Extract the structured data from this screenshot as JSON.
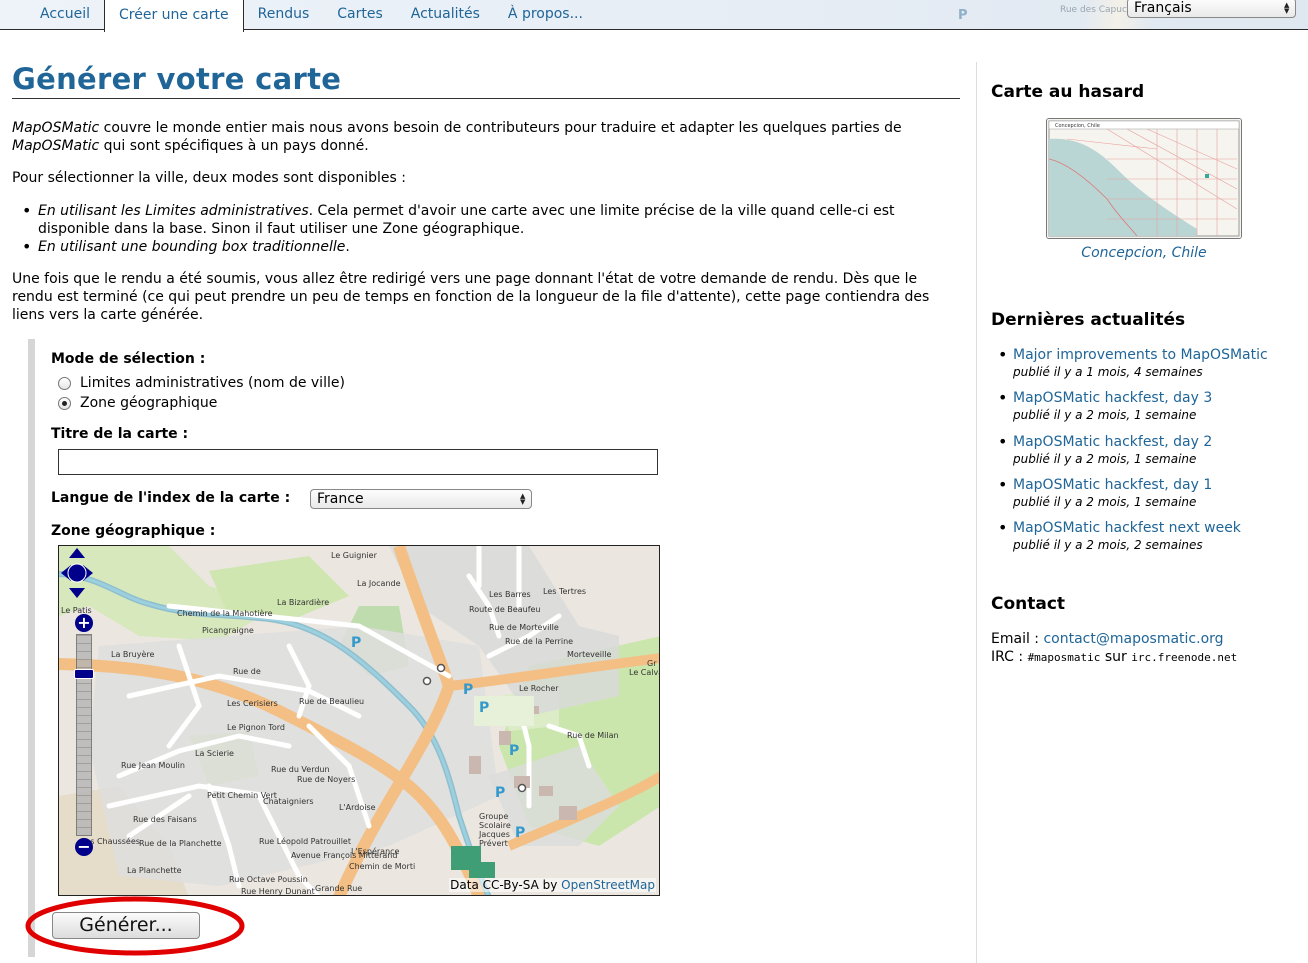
{
  "nav": {
    "tabs": [
      {
        "label": "Accueil",
        "active": false
      },
      {
        "label": "Créer une carte",
        "active": true
      },
      {
        "label": "Rendus",
        "active": false
      },
      {
        "label": "Cartes",
        "active": false
      },
      {
        "label": "Actualités",
        "active": false
      },
      {
        "label": "À propos...",
        "active": false
      }
    ],
    "background_map_text": "Rue des Capucine",
    "language_select": {
      "value": "Français"
    }
  },
  "main": {
    "title": "Générer votre carte",
    "intro": {
      "brand": "MapOSMatic",
      "part1": " couvre le monde entier mais nous avons besoin de contributeurs pour traduire et adapter les quelques parties de ",
      "part2": " qui sont spécifiques à un pays donné."
    },
    "modes_intro": "Pour sélectionner la ville, deux modes sont disponibles :",
    "modes": [
      {
        "emph": "En utilisant les Limites administratives",
        "rest": ". Cela permet d'avoir une carte avec une limite précise de la ville quand celle-ci est disponible dans la base. Sinon il faut utiliser une Zone géographique."
      },
      {
        "emph": "En utilisant une bounding box traditionnelle",
        "rest": "."
      }
    ],
    "redirect_text": "Une fois que le rendu a été soumis, vous allez être redirigé vers une page donnant l'état de votre demande de rendu. Dès que le rendu est terminé (ce qui peut prendre un peu de temps en fonction de la longueur de la file d'attente), cette page contiendra des liens vers la carte générée."
  },
  "form": {
    "mode_label": "Mode de sélection :",
    "radio_options": [
      {
        "label": "Limites administratives (nom de ville)",
        "checked": false
      },
      {
        "label": "Zone géographique",
        "checked": true
      }
    ],
    "title_label": "Titre de la carte :",
    "title_value": "",
    "index_language_label": "Langue de l'index de la carte :",
    "index_language_value": "France",
    "zone_label": "Zone géographique :",
    "generate_label": "Générer...",
    "highlight_color": "#e00000"
  },
  "map": {
    "attribution_prefix": "Data CC-By-SA by ",
    "attribution_link": "OpenStreetMap",
    "zoom_in": "+",
    "zoom_out": "−",
    "zoom_level_fraction": 0.18,
    "labels": [
      "Le Guignier",
      "La Jocande",
      "Les Barres",
      "Les Tertres",
      "La Bizardière",
      "Chemin de la Mahotière",
      "Picangraigne",
      "La Bruyère",
      "Rue de",
      "Le Patis",
      "Les Cerisiers",
      "Rue de Beaulieu",
      "Le Pignon Tord",
      "La Scierie",
      "Rue Jean Moulin",
      "Rue des Faisans",
      "Petit Chemin Vert",
      "Chataigniers",
      "L'Ardoise",
      "Le Rocher",
      "Morteveille",
      "Rue de la Perrine",
      "Rue de Morteville",
      "Route de Beaufeu",
      "Rue de Milan",
      "Le Calvaire",
      "Gr",
      "Groupe",
      "Scolaire",
      "Jacques",
      "Prévert",
      "L'Espérance",
      "Grande Rue",
      "Chemin de Morti",
      "Rue Octave Poussin",
      "Avenue François Mitterand",
      "Rue Henry Dunant",
      "La Planchette",
      "Rue de la Planchette",
      "Rue du Verdun",
      "Rue de Noyers",
      "Rue Léopold Patrouillet",
      "Les Chaussées"
    ],
    "parking_symbol": "P",
    "colors": {
      "background": "#eae6df",
      "residential": "#dddddd",
      "green": "#c8e6a8",
      "road_major": "#f5c48a",
      "water": "#aad3df",
      "park": "#8fc19a"
    }
  },
  "sidebar": {
    "random_title": "Carte au hasard",
    "random_map_label": "Concepcion, Chile",
    "random_caption": "Concepcion, Chile",
    "news_title": "Dernières actualités",
    "news": [
      {
        "title": "Major improvements to MapOSMatic",
        "date": "publié il y a 1 mois, 4 semaines"
      },
      {
        "title": "MapOSMatic hackfest, day 3",
        "date": "publié il y a 2 mois, 1 semaine"
      },
      {
        "title": "MapOSMatic hackfest, day 2",
        "date": "publié il y a 2 mois, 1 semaine"
      },
      {
        "title": "MapOSMatic hackfest, day 1",
        "date": "publié il y a 2 mois, 1 semaine"
      },
      {
        "title": "MapOSMatic hackfest next week",
        "date": "publié il y a 2 mois, 2 semaines"
      }
    ],
    "contact_title": "Contact",
    "email_label": "Email : ",
    "email": "contact@maposmatic.org",
    "irc_label": "IRC : ",
    "irc_channel": "#maposmatic",
    "irc_sep": " sur ",
    "irc_server": "irc.freenode.net"
  }
}
